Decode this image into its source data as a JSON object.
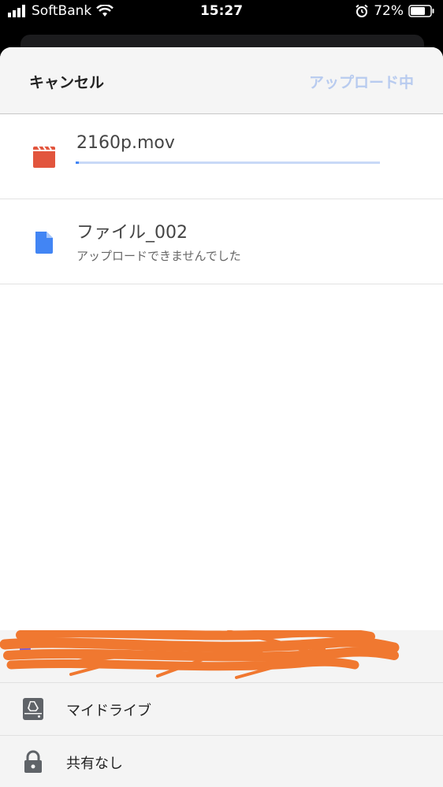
{
  "status_bar": {
    "carrier": "SoftBank",
    "time": "15:27",
    "battery": "72%"
  },
  "header": {
    "cancel_label": "キャンセル",
    "uploading_label": "アップロード中"
  },
  "files": [
    {
      "name": "2160p.mov",
      "icon": "video-clapper-icon",
      "progress": 0.01
    },
    {
      "name": "ファイル_002",
      "icon": "document-icon",
      "status": "アップロードできませんでした"
    }
  ],
  "destination": {
    "items": [
      {
        "label": "マイドライブ",
        "icon": "drive-icon"
      },
      {
        "label": "共有なし",
        "icon": "lock-icon"
      }
    ]
  },
  "colors": {
    "accent": "#4285f4",
    "video_icon": "#e2553d",
    "uploading_disabled": "#b8cbef"
  }
}
